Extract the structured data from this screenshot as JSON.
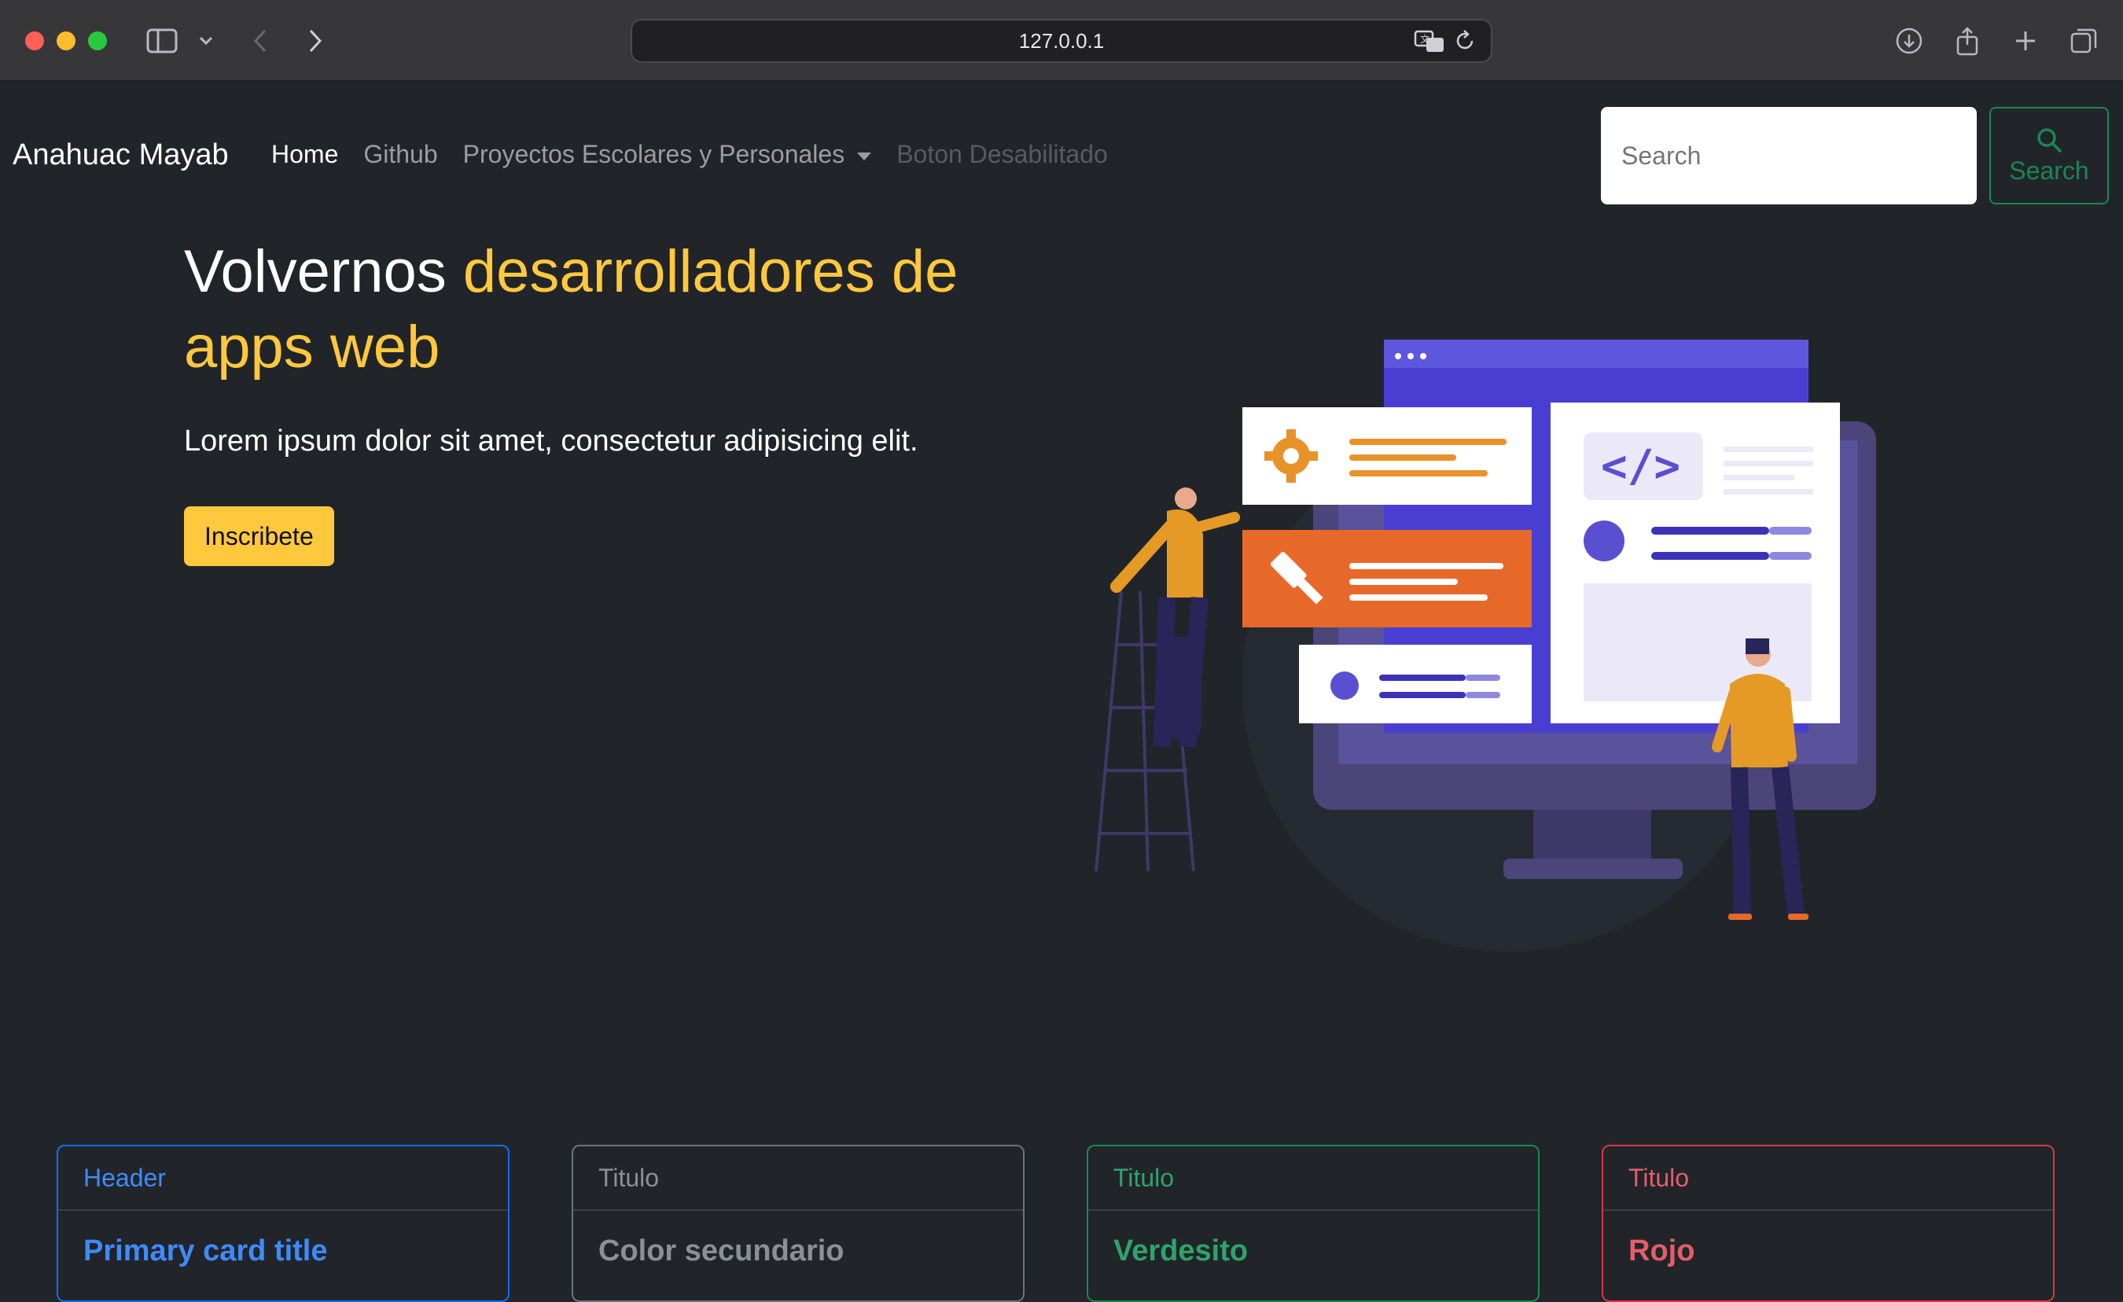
{
  "browser": {
    "url": "127.0.0.1",
    "icons": [
      "sidebar-icon",
      "chevron-down-icon",
      "back-icon",
      "forward-icon",
      "translate-icon",
      "reload-icon",
      "download-icon",
      "share-icon",
      "new-tab-icon",
      "tabs-overview-icon"
    ]
  },
  "navbar": {
    "brand": "Anahuac Mayab",
    "links": [
      {
        "label": "Home",
        "state": "active"
      },
      {
        "label": "Github",
        "state": "normal"
      },
      {
        "label": "Proyectos Escolares y Personales",
        "state": "dropdown"
      },
      {
        "label": "Boton Desabilitado",
        "state": "disabled"
      }
    ],
    "search_placeholder": "Search",
    "search_button": "Search"
  },
  "hero": {
    "title_plain": "Volvernos ",
    "title_highlight": "desarrolladores de apps web",
    "lead": "Lorem ipsum dolor sit amet, consectetur adipisicing elit.",
    "cta": "Inscribete"
  },
  "cards": [
    {
      "header": "Header",
      "title": "Primary card title",
      "variant": "primary",
      "color": "#0d6efd"
    },
    {
      "header": "Titulo",
      "title": "Color secundario",
      "variant": "secondary",
      "color": "#6c757d"
    },
    {
      "header": "Titulo",
      "title": "Verdesito",
      "variant": "success",
      "color": "#198754"
    },
    {
      "header": "Titulo",
      "title": "Rojo",
      "variant": "danger",
      "color": "#dc3545"
    }
  ],
  "colors": {
    "background": "#212529",
    "accent_yellow": "#ffc83d",
    "success": "#198754"
  }
}
